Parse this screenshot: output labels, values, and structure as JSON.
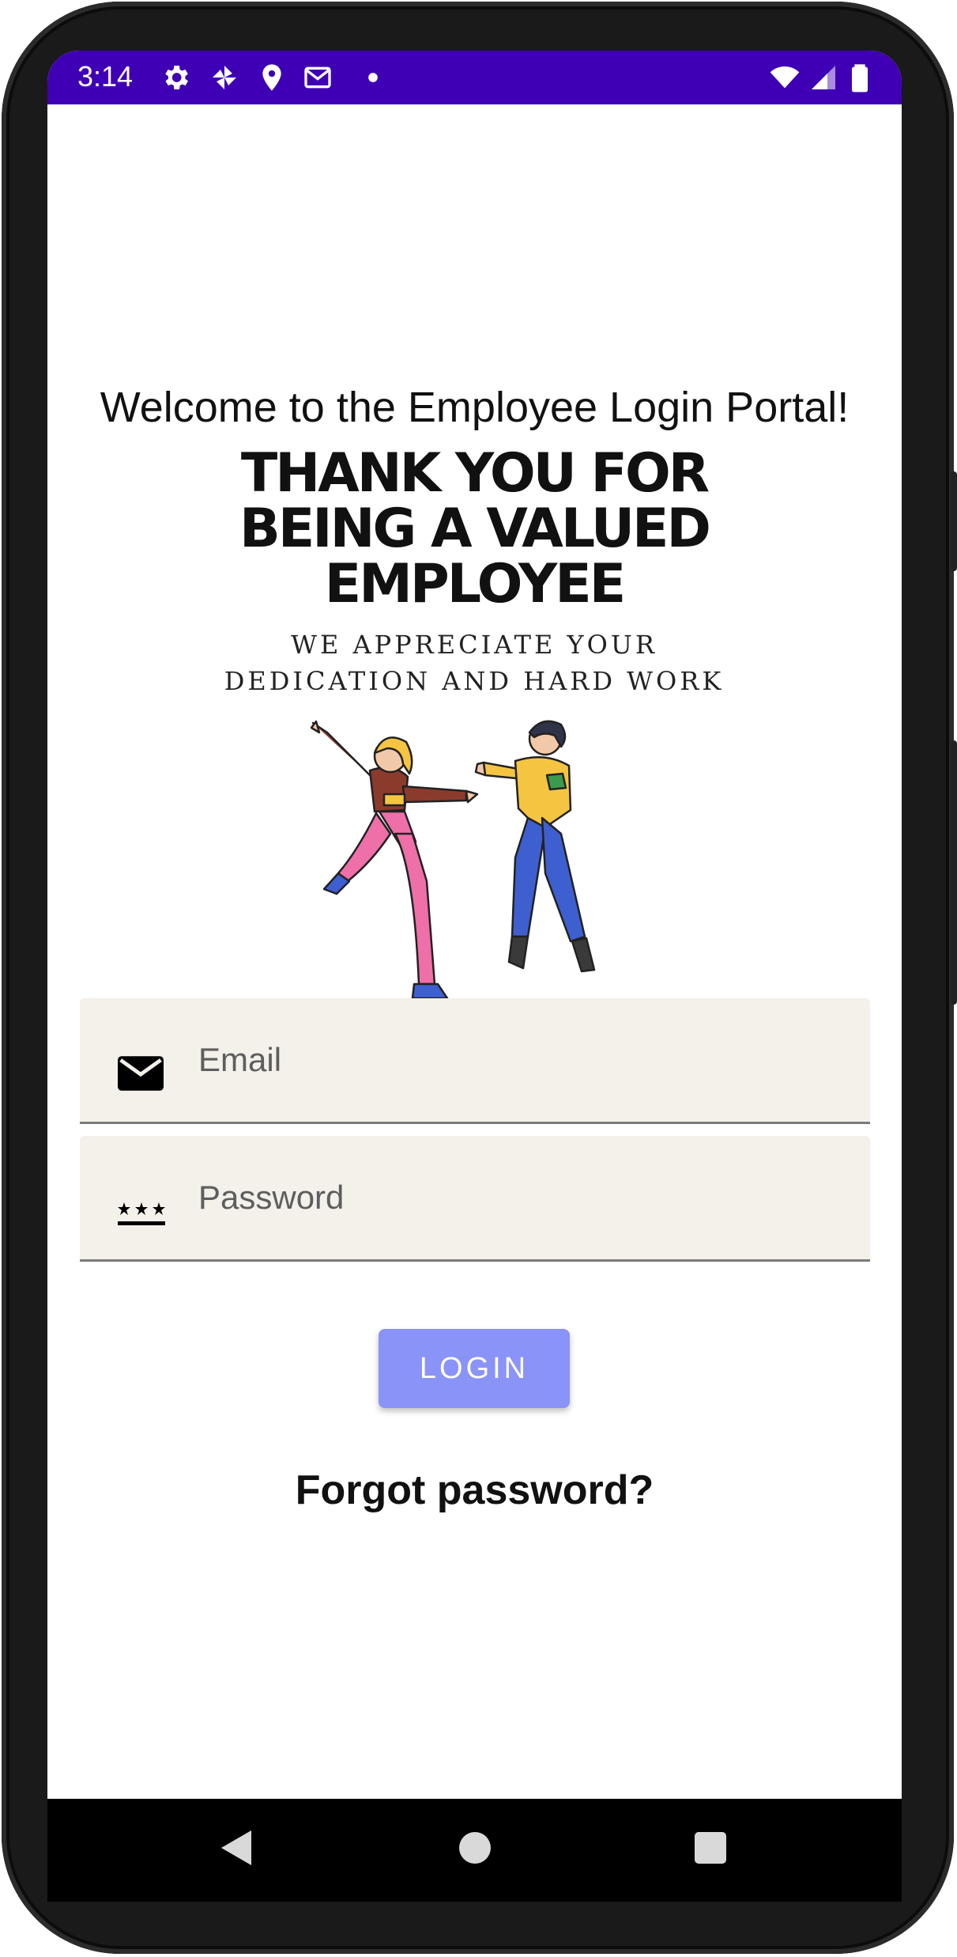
{
  "status_bar": {
    "time": "3:14",
    "background_color": "#3f00b5",
    "left_icons": [
      "gear-icon",
      "pinwheel-icon",
      "location-pin-icon",
      "gmail-icon",
      "notification-dot-icon"
    ],
    "right_icons": [
      "wifi-icon",
      "cell-signal-icon",
      "battery-icon"
    ]
  },
  "welcome_text": "Welcome to the Employee Login Portal!",
  "banner": {
    "headline": "THANK YOU FOR\nBEING A VALUED\nEMPLOYEE",
    "subtext": "WE APPRECIATE YOUR\nDEDICATION AND HARD WORK",
    "illustration": "two-dancing-people-illustration"
  },
  "email_field": {
    "placeholder": "Email",
    "value": "",
    "icon": "envelope-icon"
  },
  "password_field": {
    "placeholder": "Password",
    "value": "",
    "icon": "password-dots-icon"
  },
  "login_button": {
    "label": "LOGIN",
    "color": "#8a93f7"
  },
  "forgot_password_link": "Forgot password?",
  "nav_bar": {
    "buttons": [
      "back-triangle-icon",
      "home-circle-icon",
      "recents-square-icon"
    ]
  }
}
